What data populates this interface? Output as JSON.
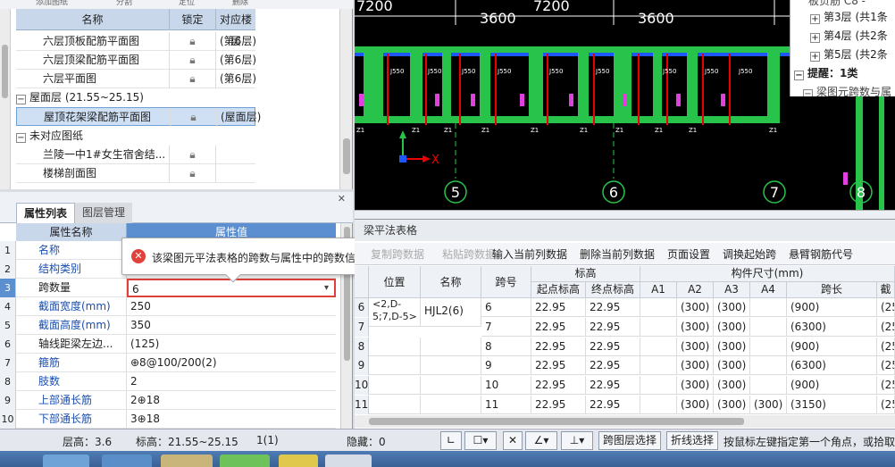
{
  "drawing_list": {
    "header": {
      "name": "名称",
      "lock": "锁定",
      "floor": "对应楼层"
    },
    "top_partial": [
      "添加图纸",
      "分割",
      "定位",
      "删除"
    ],
    "rows": [
      {
        "name": "六层顶板配筋平面图",
        "floor": "(第6层)"
      },
      {
        "name": "六层顶梁配筋平面图",
        "floor": "(第6层)"
      },
      {
        "name": "六层平面图",
        "floor": "(第6层)"
      }
    ],
    "group_roof": "屋面层 (21.55~25.15)",
    "selected_row": {
      "name": "屋顶花架梁配筋平面图",
      "floor": "(屋面层)"
    },
    "group_unmatched": "未对应图纸",
    "unmatched_rows": [
      {
        "name": "兰陵一中1#女生宿舍结..."
      },
      {
        "name": "楼梯剖面图"
      }
    ]
  },
  "prop_panel": {
    "tab_active": "属性列表",
    "tab_inactive": "图层管理",
    "col_name": "属性名称",
    "col_value": "属性值",
    "rows": [
      {
        "i": "1",
        "name": "名称",
        "value": "",
        "blue": true
      },
      {
        "i": "2",
        "name": "结构类别",
        "value": "",
        "blue": true
      },
      {
        "i": "3",
        "name": "跨数量",
        "value": "6",
        "blue": false
      },
      {
        "i": "4",
        "name": "截面宽度(mm)",
        "value": "250",
        "blue": true
      },
      {
        "i": "5",
        "name": "截面高度(mm)",
        "value": "350",
        "blue": true
      },
      {
        "i": "6",
        "name": "轴线距梁左边...",
        "value": "(125)",
        "blue": false
      },
      {
        "i": "7",
        "name": "箍筋",
        "value": "⊕8@100/200(2)",
        "blue": true
      },
      {
        "i": "8",
        "name": "肢数",
        "value": "2",
        "blue": true
      },
      {
        "i": "9",
        "name": "上部通长筋",
        "value": "2⊕18",
        "blue": true
      },
      {
        "i": "10",
        "name": "下部通长筋",
        "value": "3⊕18",
        "blue": true
      }
    ]
  },
  "tooltip": {
    "message": "该梁图元平法表格的跨数与属性中的跨数信息不相同，请核查"
  },
  "cad": {
    "dims": [
      "7200",
      "3600",
      "7200",
      "3600"
    ],
    "axes": [
      "5",
      "6",
      "7",
      "8"
    ],
    "x_axis_label": "X",
    "beam_labels": [
      "J550",
      "J550",
      "J550",
      "J550",
      "J550",
      "J550",
      "J550",
      "J550",
      "J550"
    ],
    "beam_ids": [
      "Z1",
      "Z1",
      "Z1",
      "Z1",
      "Z1",
      "Z1",
      "Z1",
      "Z1",
      "Z1",
      "Z1"
    ]
  },
  "floor_tree": {
    "top_partial": "板负筋 C8 -",
    "items": [
      {
        "expander": "+",
        "label": "第3层 (共1条"
      },
      {
        "expander": "+",
        "label": "第4层 (共2条"
      },
      {
        "expander": "+",
        "label": "第5层 (共2条"
      }
    ],
    "hint": "提醒：1类",
    "hint_sub": "梁图元跨数与属"
  },
  "beam_table": {
    "title": "梁平法表格",
    "toolbar": [
      "复制跨数据",
      "粘贴跨数据",
      "输入当前列数据",
      "删除当前列数据",
      "页面设置",
      "调换起始跨",
      "悬臂钢筋代号"
    ],
    "headers": {
      "position": "位置",
      "name": "名称",
      "span": "跨号",
      "elevation": "标高",
      "start_elev": "起点标高",
      "end_elev": "终点标高",
      "section": "构件尺寸(mm)",
      "a1": "A1",
      "a2": "A2",
      "a3": "A3",
      "a4": "A4",
      "span_len": "跨长",
      "more": "截"
    },
    "position_value": "<2,D-5;7,D-5>",
    "name_value": "HJL2(6)",
    "rows": [
      {
        "i": "6",
        "span": "6",
        "s": "22.95",
        "e": "22.95",
        "a1": "",
        "a2": "(300)",
        "a3": "(300)",
        "a4": "",
        "len": "(900)",
        "more": "(25"
      },
      {
        "i": "7",
        "span": "7",
        "s": "22.95",
        "e": "22.95",
        "a1": "",
        "a2": "(300)",
        "a3": "(300)",
        "a4": "",
        "len": "(6300)",
        "more": "(25"
      },
      {
        "i": "8",
        "span": "8",
        "s": "22.95",
        "e": "22.95",
        "a1": "",
        "a2": "(300)",
        "a3": "(300)",
        "a4": "",
        "len": "(900)",
        "more": "(25"
      },
      {
        "i": "9",
        "span": "9",
        "s": "22.95",
        "e": "22.95",
        "a1": "",
        "a2": "(300)",
        "a3": "(300)",
        "a4": "",
        "len": "(6300)",
        "more": "(25"
      },
      {
        "i": "10",
        "span": "10",
        "s": "22.95",
        "e": "22.95",
        "a1": "",
        "a2": "(300)",
        "a3": "(300)",
        "a4": "",
        "len": "(900)",
        "more": "(25"
      },
      {
        "i": "11",
        "span": "11",
        "s": "22.95",
        "e": "22.95",
        "a1": "",
        "a2": "(300)",
        "a3": "(300)",
        "a4": "(300)",
        "len": "(3150)",
        "more": "(25"
      }
    ]
  },
  "status": {
    "floor_height": "层高：3.6",
    "elevation": "标高：21.55~25.15",
    "count": "1(1)",
    "hidden": "隐藏：0",
    "layer_select": "跨图层选择",
    "polyline_select": "折线选择",
    "hint": "按鼠标左键指定第一个角点，或拾取"
  }
}
